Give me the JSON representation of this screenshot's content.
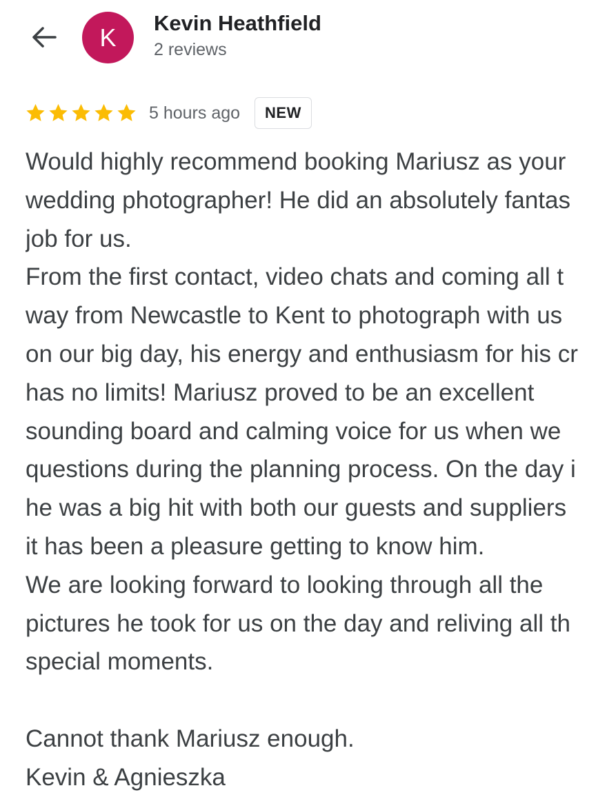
{
  "header": {
    "back_icon": "arrow-left-icon",
    "avatar_letter": "K",
    "avatar_color": "#c2185b",
    "reviewer_name": "Kevin Heathfield",
    "reviewer_meta": "2 reviews"
  },
  "rating": {
    "stars": 5,
    "max_stars": 5,
    "star_color": "#fbbc04",
    "time": "5 hours ago",
    "badge": "NEW"
  },
  "review": {
    "lines": [
      "Would highly recommend booking Mariusz as your",
      "wedding photographer! He did an absolutely fantas",
      "job for us.",
      "From the first contact, video chats and coming all t",
      "way from Newcastle to Kent to photograph with us",
      "on our big day, his energy and enthusiasm for his cr",
      "has no limits! Mariusz proved to be an excellent",
      "sounding board and calming voice for us when we",
      "questions during the planning process. On the day i",
      "he was a big hit with both our guests and suppliers",
      "it has been a pleasure getting to know him.",
      "We are looking forward to looking through all the",
      "pictures he took for us on the day and reliving all th",
      "special moments.",
      "",
      "Cannot thank Mariusz enough.",
      "Kevin & Agnieszka"
    ]
  }
}
